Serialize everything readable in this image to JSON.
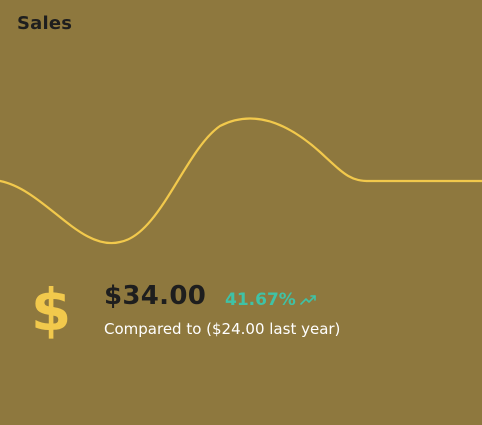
{
  "card": {
    "title": "Sales",
    "amount": "$34.00",
    "change_percent": "41.67%",
    "comparison_text": "Compared to ($24.00 last year)"
  },
  "icons": {
    "currency": "dollar-sign-icon",
    "trend": "trending-up-icon"
  },
  "colors": {
    "background": "#8E783E",
    "sparkline": "#F2C94C",
    "dollar_icon": "#F2C94C",
    "positive_change": "#3FC2A6",
    "title_text": "#1E1E1E",
    "comparison_text": "#FFFFFF"
  }
}
